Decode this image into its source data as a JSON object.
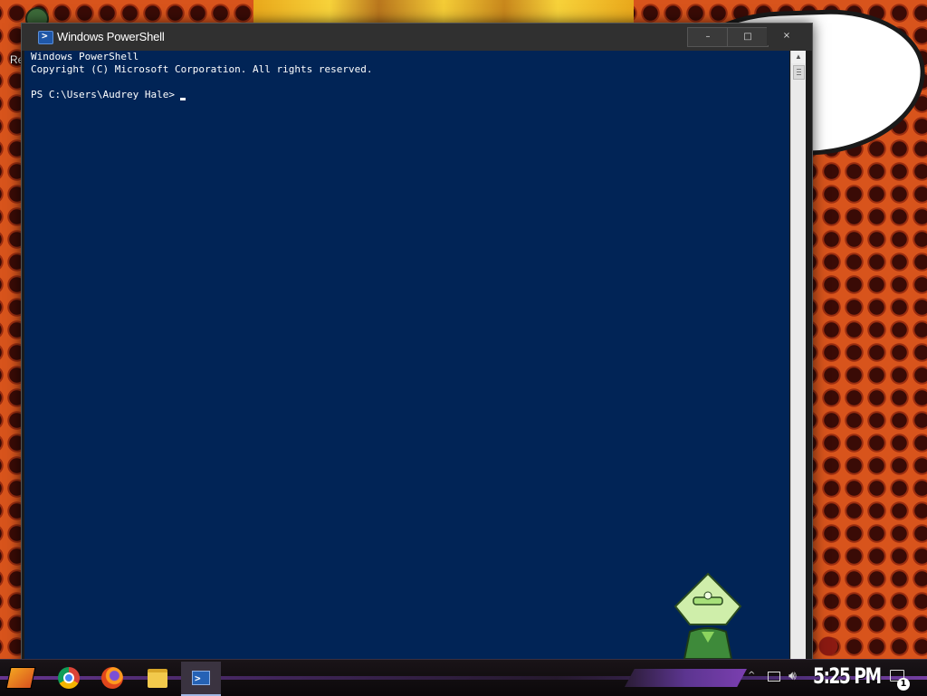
{
  "desktop": {
    "left_label": "Re"
  },
  "window": {
    "title": "Windows PowerShell",
    "minimize_glyph": "–",
    "maximize_glyph": "□",
    "close_glyph": "×"
  },
  "console": {
    "lines": [
      "Windows PowerShell",
      "Copyright (C) Microsoft Corporation. All rights reserved.",
      "PS C:\\Users\\Audrey Hale>"
    ],
    "colors": {
      "background": "#012456",
      "text": "#ffffff"
    }
  },
  "taskbar": {
    "apps": [
      "start-icon",
      "chrome-icon",
      "firefox-icon",
      "file-explorer-icon",
      "powershell-icon"
    ],
    "tray": {
      "chevron": "^",
      "clock": "5:25 PM",
      "notifications_count": "1"
    }
  }
}
